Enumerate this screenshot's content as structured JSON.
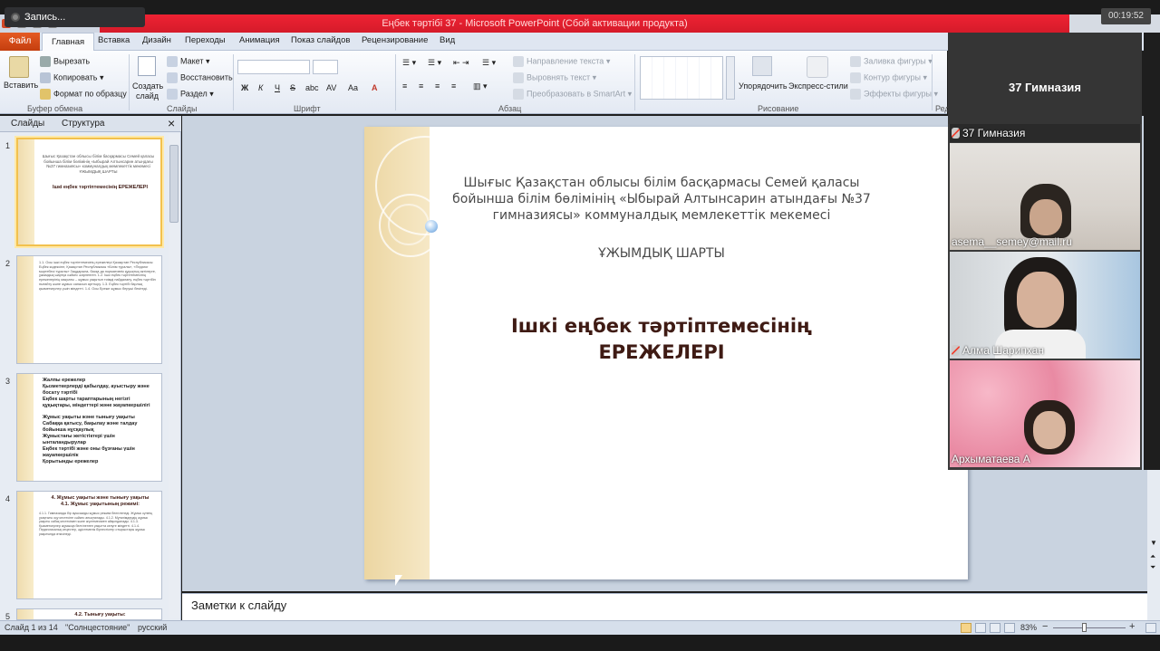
{
  "overlay": {
    "recording_label": "Запись...",
    "timer": "00:19:52"
  },
  "window": {
    "title": "Еңбек тәртібі 37  -  Microsoft PowerPoint (Сбой активации продукта)"
  },
  "ribbon_tabs": [
    "Файл",
    "Главная",
    "Вставка",
    "Дизайн",
    "Переходы",
    "Анимация",
    "Показ слайдов",
    "Рецензирование",
    "Вид"
  ],
  "ribbon": {
    "clipboard": {
      "paste": "Вставить",
      "cut": "Вырезать",
      "copy": "Копировать",
      "format_painter": "Формат по образцу",
      "group": "Буфер обмена"
    },
    "slides": {
      "new_slide_1": "Создать",
      "new_slide_2": "слайд",
      "layout": "Макет",
      "reset": "Восстановить",
      "section": "Раздел",
      "group": "Слайды"
    },
    "font": {
      "group": "Шрифт",
      "bold": "Ж",
      "italic": "К",
      "underline": "Ч",
      "strike": "S",
      "abc": "abc",
      "spacing": "AV",
      "case": "Aa",
      "color": "A"
    },
    "paragraph": {
      "text_direction": "Направление текста",
      "align_text": "Выровнять текст",
      "smartart": "Преобразовать в SmartArt",
      "group": "Абзац"
    },
    "drawing": {
      "arrange": "Упорядочить",
      "quick_styles": "Экспресс-стили",
      "shape_fill": "Заливка фигуры",
      "shape_outline": "Контур фигуры",
      "shape_effects": "Эффекты фигуры",
      "group": "Рисование",
      "cut_label": "Ред"
    }
  },
  "left_panel": {
    "tab_slides": "Слайды",
    "tab_outline": "Структура",
    "close": "×",
    "thumbs": [
      {
        "num": "1",
        "header": "Шығыс Қазақстан облысы білім басқармасы Семей қаласы бойынша білім бөлімінің «Ыбырай Алтынсарин атындағы №37 гимназиясы» коммуналдық мемлекеттік мекемесі",
        "sub": "ҰЖЫМДЫҚ ШАРТЫ",
        "title": "Ішкі еңбек тәртіптемесінің ЕРЕЖЕЛЕРІ"
      },
      {
        "num": "2",
        "body": "1.1. Осы ішкі еңбек тәртіптемесінің ережелері Қазақстан Республикасы Еңбек кодексіне, Қазақстан Республикасы «Білім туралы», «Педагог мәртебесі туралы» Заңдарына, басқа да нормативтік құқықтық актілерге, ұжымдық шартқа сәйкес әзірленген. 1.2. Ішкі еңбек тәртіптемесінің ережелерінің мақсаты – жұмыс уақытын тиімді пайдалану, еңбек тәртібін нығайту және жұмыс сапасын арттыру. 1.3. Еңбек тәртібі барлық қызметкерлер үшін міндетті. 1.4. Осы Ереже жұмыс беруші бекітеді."
      },
      {
        "num": "3",
        "items": [
          "Жалпы ережелер",
          "Қызметкерлерді қабылдау, ауыстыру және босату тәртібі",
          "Еңбек шарты тараптарының негізгі құқықтары, міндеттері және жауапкершілігі",
          "Жұмыс уақыты және тынығу уақыты",
          "Сабаққа қатысу, бақылау және талдау бойынша нұсқаулық",
          "Жұмыстағы жетістіктері үшін ынталандырулар",
          "Еңбек тәртібі және оны бұзғаны үшін жауапкершілік",
          "Қорытынды ережелер"
        ]
      },
      {
        "num": "4",
        "title": "4. Жұмыс уақыты және тынығу уақыты",
        "subtitle": "4.1. Жұмыс уақытының режимі:",
        "body": "4.1.1. Гимназияда бір ауысымды жұмыс режимі белгіленеді. Жұмыс күнінің ұзақтығы оқу кестесіне сәйкес анықталады. 4.1.2. Мұғалімдердің жұмыс уақыты сабақ кестесімен және жүктемесімен айқындалады. 4.1.3. Қызметкерлер жұмысқа белгіленген уақытта келуге міндетті. 4.1.4. Педагогикалық кеңестер, әдістемелік бірлестіктер отырыстары жұмыс уақытында өткізіледі."
      },
      {
        "num": "5",
        "title": "4.2. Тынығу уақыты:"
      }
    ]
  },
  "slide": {
    "header": "Шығыс Қазақстан облысы білім басқармасы Семей қаласы бойынша білім бөлімінің «Ыбырай Алтынсарин атындағы №37 гимназиясы» коммуналдық мемлекеттік мекемесі",
    "subtitle": "ҰЖЫМДЫҚ ШАРТЫ",
    "title_line1": "Ішкі еңбек тәртіптемесінің",
    "title_line2": "ЕРЕЖЕЛЕРІ"
  },
  "notes": {
    "placeholder": "Заметки к слайду"
  },
  "status": {
    "slide_counter": "Слайд 1 из 14",
    "theme": "\"Солнцестояние\"",
    "language": "русский",
    "zoom": "83%",
    "zoom_minus": "−",
    "zoom_plus": "+"
  },
  "video_panel": {
    "host_name": "37 Гимназия",
    "participants": [
      {
        "name": "37 Гимназия",
        "muted": true
      },
      {
        "name": "asema__semey@mail.ru",
        "muted": false
      },
      {
        "name": "Алма Шарипхан",
        "muted": true
      },
      {
        "name": "Архыматаева А",
        "muted": false
      }
    ]
  }
}
